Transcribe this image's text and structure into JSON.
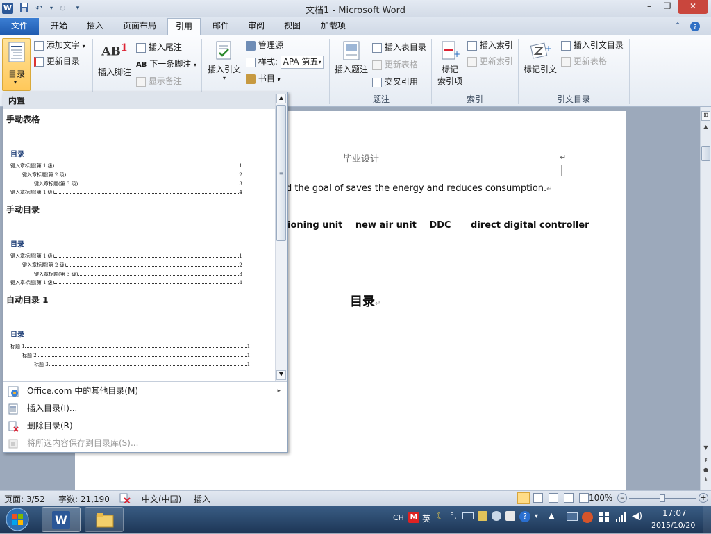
{
  "window": {
    "title": "文档1 - Microsoft Word",
    "app_icon": "W",
    "minimize": "–",
    "maximize": "❐",
    "close": "✕"
  },
  "quick_access": {
    "save_icon": "save-icon",
    "undo_icon": "undo-icon",
    "redo_icon": "redo-icon",
    "customize_icon": "customize-icon"
  },
  "tabs": [
    "文件",
    "开始",
    "插入",
    "页面布局",
    "引用",
    "邮件",
    "审阅",
    "视图",
    "加载项"
  ],
  "active_tab": "引用",
  "ribbon": {
    "toc_group": {
      "toc_button": "目录",
      "add_text": "添加文字",
      "update_toc": "更新目录"
    },
    "footnote_group": {
      "insert_footnote": "插入脚注",
      "insert_endnote": "插入尾注",
      "next_footnote": "下一条脚注",
      "show_notes": "显示备注",
      "big_icon_text": "AB",
      "big_icon_sup": "1",
      "next_icon_text": "AB"
    },
    "citation_group": {
      "insert_citation": "插入引文",
      "manage_sources": "管理源",
      "style_label": "样式:",
      "style_value": "APA 第五",
      "bibliography": "书目"
    },
    "caption_group": {
      "insert_caption": "插入题注",
      "insert_table_of_figures": "插入表目录",
      "update_table": "更新表格",
      "cross_reference": "交叉引用",
      "label": "题注"
    },
    "index_group": {
      "mark_entry_line1": "标记",
      "mark_entry_line2": "索引项",
      "insert_index": "插入索引",
      "update_index": "更新索引",
      "label": "索引"
    },
    "toa_group": {
      "mark_citation": "标记引文",
      "insert_toa": "插入引文目录",
      "update_table": "更新表格",
      "label": "引文目录"
    }
  },
  "dropdown": {
    "header": "内置",
    "sections": [
      {
        "title": "手动表格",
        "toc_heading": "目录",
        "rows": [
          {
            "text": "键入章标题(第 1 级)",
            "page": "1"
          },
          {
            "text": "键入章标题(第 2 级)",
            "page": "2"
          },
          {
            "text": "键入章标题(第 3 级)",
            "page": "3"
          },
          {
            "text": "键入章标题(第 1 级)",
            "page": "4"
          }
        ]
      },
      {
        "title": "手动目录",
        "toc_heading": "目录",
        "rows": [
          {
            "text": "键入章标题(第 1 级)",
            "page": "1"
          },
          {
            "text": "键入章标题(第 2 级)",
            "page": "2"
          },
          {
            "text": "键入章标题(第 3 级)",
            "page": "3"
          },
          {
            "text": "键入章标题(第 1 级)",
            "page": "4"
          }
        ]
      },
      {
        "title": "自动目录 1",
        "toc_heading": "目录",
        "rows": [
          {
            "text": "标题 1",
            "page": "1"
          },
          {
            "text": "标题 2",
            "page": "1"
          },
          {
            "text": "标题 3",
            "page": "1"
          }
        ]
      }
    ],
    "menu": {
      "more": "Office.com 中的其他目录(M)",
      "insert": "插入目录(I)...",
      "remove": "删除目录(R)",
      "save": "将所选内容保存到目录库(S)..."
    }
  },
  "document": {
    "header_text": "毕业设计",
    "line1": "ed the goal of saves the energy and reduces consumption.",
    "line2_parts": [
      "ioning unit",
      "new air unit",
      "DDC",
      "direct digital controller"
    ],
    "toc_title": "目录",
    "para_mark": "↵"
  },
  "status": {
    "page": "页面: 3/52",
    "words": "字数: 21,190",
    "language": "中文(中国)",
    "mode": "插入",
    "zoom": "100%",
    "zoom_minus": "–",
    "zoom_plus": "+"
  },
  "taskbar": {
    "ime_ch": "CH",
    "ime_mode": "英",
    "time": "17:07",
    "date": "2015/10/20",
    "word_label": "W"
  },
  "colors": {
    "file_tab": "#2b66bf",
    "accent": "#2b5797"
  }
}
